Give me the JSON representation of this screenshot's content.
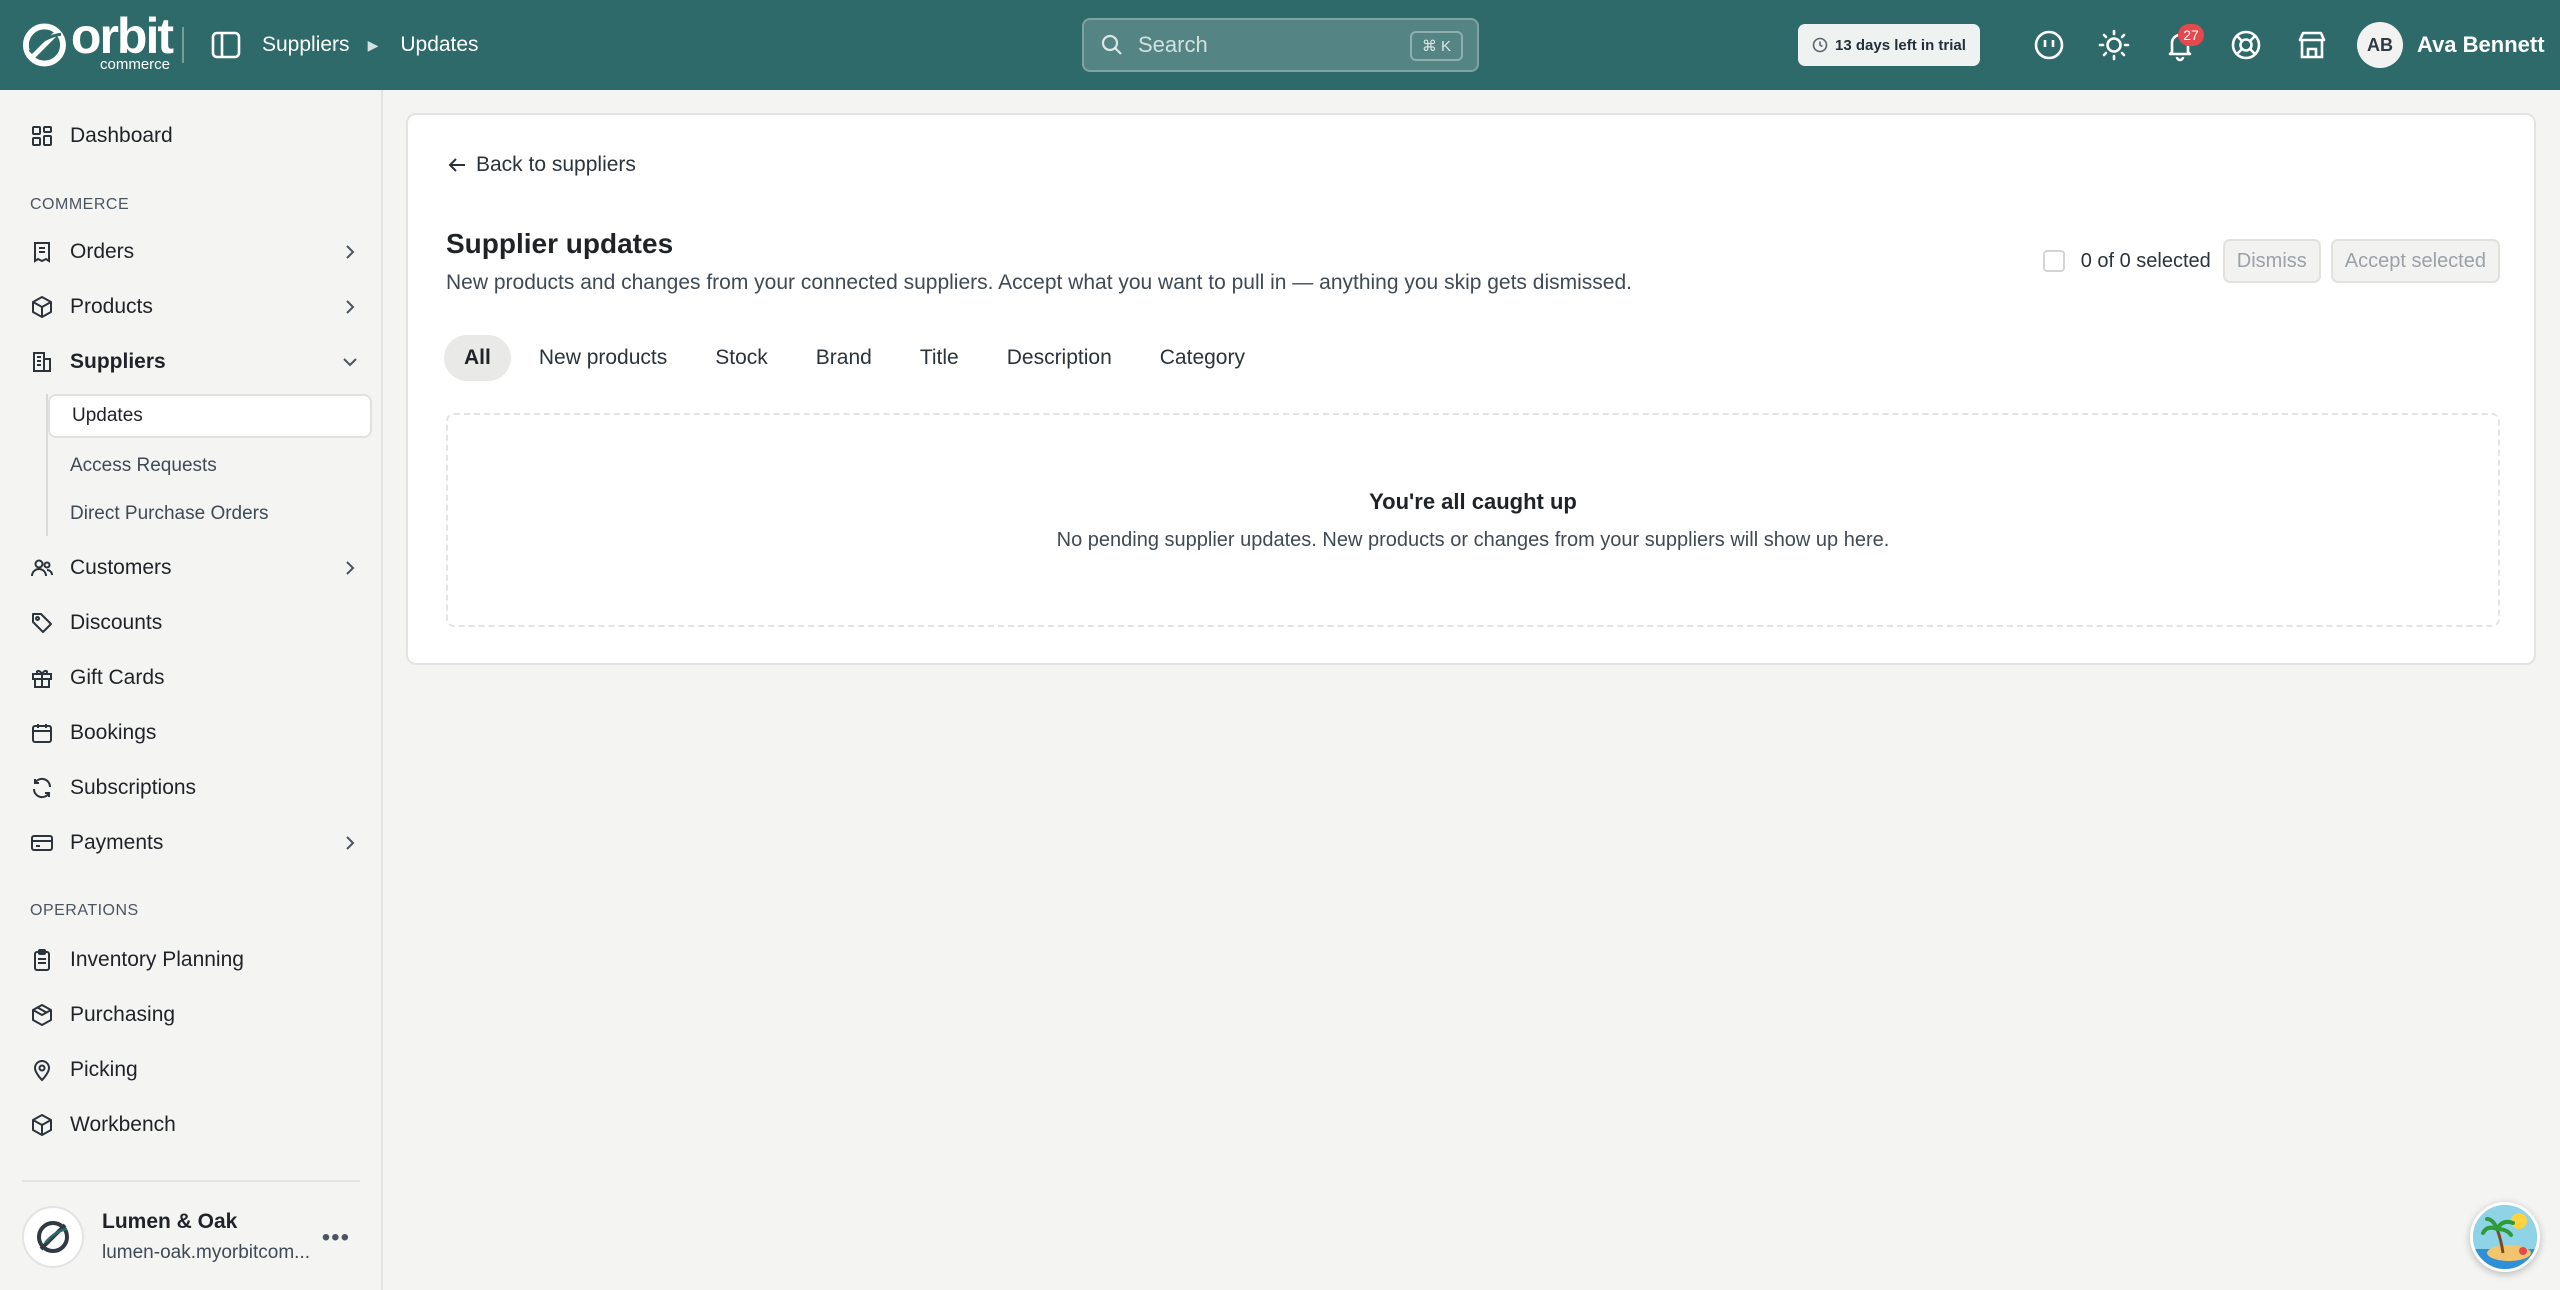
{
  "topbar": {
    "logo_word": "orbit",
    "logo_sub": "commerce",
    "breadcrumbs": [
      "Suppliers",
      "Updates"
    ],
    "search_placeholder": "Search",
    "search_shortcut": "⌘ K",
    "trial_label": "13 days left in trial",
    "notification_count": "27",
    "user_initials": "AB",
    "user_name": "Ava Bennett"
  },
  "sidebar": {
    "dashboard": "Dashboard",
    "commerce_label": "COMMERCE",
    "orders": "Orders",
    "products": "Products",
    "suppliers": "Suppliers",
    "suppliers_sub": [
      "Updates",
      "Access Requests",
      "Direct Purchase Orders"
    ],
    "customers": "Customers",
    "discounts": "Discounts",
    "gift_cards": "Gift Cards",
    "bookings": "Bookings",
    "subscriptions": "Subscriptions",
    "payments": "Payments",
    "operations_label": "OPERATIONS",
    "inventory_planning": "Inventory Planning",
    "purchasing": "Purchasing",
    "picking": "Picking",
    "workbench": "Workbench",
    "store_name": "Lumen & Oak",
    "store_domain": "lumen-oak.myorbitcom..."
  },
  "main": {
    "back_link": "Back to suppliers",
    "title": "Supplier updates",
    "subtitle": "New products and changes from your connected suppliers. Accept what you want to pull in — anything you skip gets dismissed.",
    "selection_count": "0 of 0 selected",
    "dismiss_label": "Dismiss",
    "accept_label": "Accept selected",
    "tabs": [
      "All",
      "New products",
      "Stock",
      "Brand",
      "Title",
      "Description",
      "Category"
    ],
    "empty_title": "You're all caught up",
    "empty_text": "No pending supplier updates. New products or changes from your suppliers will show up here."
  },
  "colors": {
    "topbar": "#2f6a6a",
    "badge": "#e5484d",
    "background": "#f4f4f3"
  }
}
